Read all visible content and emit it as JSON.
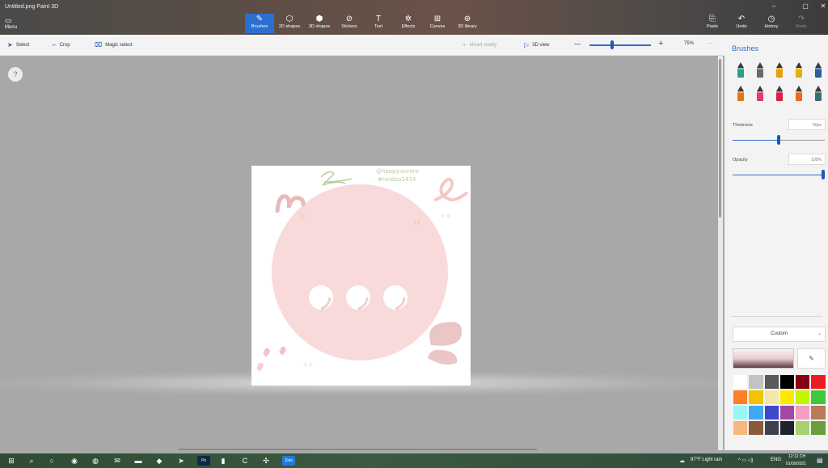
{
  "window": {
    "title": "Untitled.png   Paint 3D",
    "controls": [
      "–",
      "▢",
      "✕"
    ]
  },
  "ribbon": {
    "menu": "Menu",
    "tabs": [
      {
        "label": "Brushes",
        "icon": "brush-icon",
        "glyph": "✎",
        "active": true
      },
      {
        "label": "2D shapes",
        "icon": "shapes-2d-icon",
        "glyph": "⬡"
      },
      {
        "label": "3D shapes",
        "icon": "cube-icon",
        "glyph": "⬢"
      },
      {
        "label": "Stickers",
        "icon": "sticker-icon",
        "glyph": "⊘"
      },
      {
        "label": "Text",
        "icon": "text-icon",
        "glyph": "T"
      },
      {
        "label": "Effects",
        "icon": "effects-icon",
        "glyph": "✲"
      },
      {
        "label": "Canvas",
        "icon": "canvas-icon",
        "glyph": "⊞"
      },
      {
        "label": "3D library",
        "icon": "library-icon",
        "glyph": "⊛"
      }
    ],
    "right": [
      {
        "label": "Paste",
        "icon": "paste-icon",
        "glyph": "⎘"
      },
      {
        "label": "Undo",
        "icon": "undo-icon",
        "glyph": "↶"
      },
      {
        "label": "History",
        "icon": "history-icon",
        "glyph": "◷"
      },
      {
        "label": "Redo",
        "icon": "redo-icon",
        "glyph": "↷"
      }
    ]
  },
  "toolbar": {
    "select": "Select",
    "crop": "Crop",
    "magic_select": "Magic select",
    "mixed_reality": "Mixed reality",
    "view_3d": "3D view",
    "zoom_minus": "—",
    "zoom_plus": "+",
    "zoom": "75%",
    "more": "···"
  },
  "canvas": {
    "help": "?",
    "credit_line1": "@happy.aurora",
    "credit_line2": "#noidea2474"
  },
  "panel": {
    "title": "Brushes",
    "thickness_label": "Thickness",
    "thickness_value": "50px",
    "thickness_level": 0.5,
    "opacity_label": "Opacity",
    "opacity_value": "100%",
    "opacity_level": 1.0,
    "color_mode": "Custom",
    "brushes": [
      {
        "name": "marker-icon",
        "color": "#2e9e8a"
      },
      {
        "name": "calligraphy-pen-icon",
        "color": "#6a6a6a"
      },
      {
        "name": "oil-brush-icon",
        "color": "#e2a10a"
      },
      {
        "name": "watercolor-icon",
        "color": "#e2b20a"
      },
      {
        "name": "pixel-pen-icon",
        "color": "#2d5d9f"
      },
      {
        "name": "pencil-icon",
        "color": "#e27a12"
      },
      {
        "name": "eraser-icon",
        "color": "#e03a7a"
      },
      {
        "name": "crayon-icon",
        "color": "#d91e4a"
      },
      {
        "name": "spray-can-icon",
        "color": "#ec6a1c"
      },
      {
        "name": "fill-icon",
        "color": "#3c6d72"
      }
    ],
    "palette": [
      "#ffffff",
      "#c3c3c3",
      "#5a5a5a",
      "#000000",
      "#880015",
      "#ed1c24",
      "#ff7f27",
      "#f2c400",
      "#f5e6a8",
      "#ffe800",
      "#c3f500",
      "#3fc83b",
      "#99f6f6",
      "#3fa9f5",
      "#3f48cc",
      "#a349a4",
      "#f39ec0",
      "#b97a57",
      "#f4b87e",
      "#8a5a3a",
      "#3b4350",
      "#1f2229",
      "#a6d26e",
      "#6a9e3a"
    ]
  },
  "taskbar": {
    "apps": [
      {
        "name": "start-icon",
        "glyph": "⊞"
      },
      {
        "name": "search-icon",
        "glyph": "⌕"
      },
      {
        "name": "task-view-icon",
        "glyph": "○"
      },
      {
        "name": "edge-icon",
        "glyph": "◉"
      },
      {
        "name": "firefox-icon",
        "glyph": "◍"
      },
      {
        "name": "mail-icon",
        "glyph": "✉"
      },
      {
        "name": "files-icon",
        "glyph": "▬"
      },
      {
        "name": "drawing-app-icon",
        "glyph": "◆"
      },
      {
        "name": "telegram-icon",
        "glyph": "➤"
      },
      {
        "name": "photoshop-icon",
        "glyph": "Ps"
      },
      {
        "name": "document-icon",
        "glyph": "▮"
      },
      {
        "name": "camtasia-icon",
        "glyph": "C"
      },
      {
        "name": "team-icon",
        "glyph": "✣"
      },
      {
        "name": "zalo-icon",
        "glyph": "Zalo"
      }
    ],
    "weather": "87°F  Light rain",
    "tray_icons": "^  ▭  ◁)",
    "language": "ENG",
    "time": "12:12 CH",
    "date": "01/09/2021",
    "notifications_icon": "▤"
  }
}
